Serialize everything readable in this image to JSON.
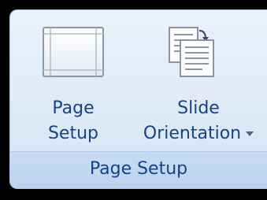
{
  "group": {
    "title": "Page Setup"
  },
  "buttons": {
    "page_setup": {
      "line1": "Page",
      "line2": "Setup",
      "icon": "page-frame-icon"
    },
    "slide_orientation": {
      "line1": "Slide",
      "line2": "Orientation",
      "icon": "slide-orientation-icon",
      "has_dropdown": true
    }
  },
  "colors": {
    "label_text": "#15428b",
    "background_top": "#eaf2fb",
    "footer": "#c4d9f1"
  }
}
